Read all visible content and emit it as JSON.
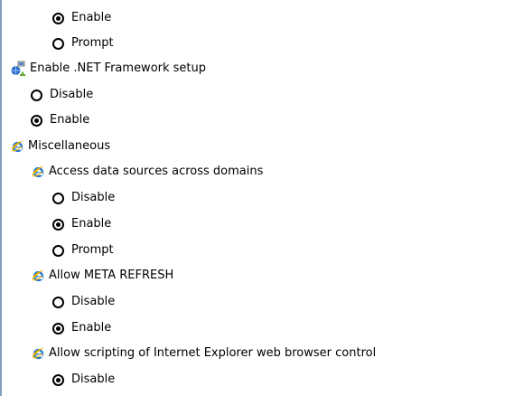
{
  "settings": {
    "top": {
      "options": [
        {
          "label": "Enable",
          "selected": true
        },
        {
          "label": "Prompt",
          "selected": false
        }
      ]
    },
    "dotnet": {
      "label": "Enable .NET Framework setup",
      "icon": "network-settings-icon",
      "options": [
        {
          "label": "Disable",
          "selected": false
        },
        {
          "label": "Enable",
          "selected": true
        }
      ]
    },
    "misc": {
      "label": "Miscellaneous",
      "icon": "internet-explorer-icon",
      "items": [
        {
          "label": "Access data sources across domains",
          "icon": "internet-explorer-icon",
          "options": [
            {
              "label": "Disable",
              "selected": false
            },
            {
              "label": "Enable",
              "selected": true
            },
            {
              "label": "Prompt",
              "selected": false
            }
          ]
        },
        {
          "label": "Allow META REFRESH",
          "icon": "internet-explorer-icon",
          "options": [
            {
              "label": "Disable",
              "selected": false
            },
            {
              "label": "Enable",
              "selected": true
            }
          ]
        },
        {
          "label": "Allow scripting of Internet Explorer web browser control",
          "icon": "internet-explorer-icon",
          "options": [
            {
              "label": "Disable",
              "selected": true
            }
          ]
        }
      ]
    }
  },
  "colors": {
    "pane_border": "#7f9db9",
    "background": "#ffffff",
    "text": "#000000",
    "ie_icon_blue": "#1f73d8",
    "ie_icon_ring": "#e8b400"
  }
}
